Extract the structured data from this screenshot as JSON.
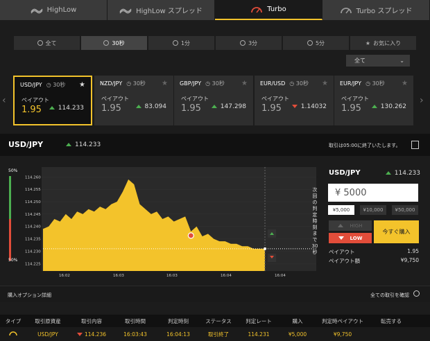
{
  "top_tabs": [
    {
      "label": "HighLow",
      "icon": "highlow-icon",
      "active": false
    },
    {
      "label": "HighLow スプレッド",
      "icon": "highlow-spread-icon",
      "active": false
    },
    {
      "label": "Turbo",
      "icon": "turbo-gauge-icon",
      "active": true
    },
    {
      "label": "Turbo スプレッド",
      "icon": "turbo-spread-gauge-icon",
      "active": false
    }
  ],
  "time_filters": [
    {
      "label": "全て",
      "active": false
    },
    {
      "label": "30秒",
      "active": true
    },
    {
      "label": "1分",
      "active": false
    },
    {
      "label": "3分",
      "active": false
    },
    {
      "label": "5分",
      "active": false
    },
    {
      "label": "お気に入り",
      "active": false
    }
  ],
  "category_select": {
    "value": "全て"
  },
  "asset_cards": [
    {
      "pair": "USD/JPY",
      "duration": "30秒",
      "payout_label": "ペイアウト",
      "payout": "1.95",
      "rate": "114.233",
      "direction": "up",
      "active": true
    },
    {
      "pair": "NZD/JPY",
      "duration": "30秒",
      "payout_label": "ペイアウト",
      "payout": "1.95",
      "rate": "83.094",
      "direction": "up",
      "active": false
    },
    {
      "pair": "GBP/JPY",
      "duration": "30秒",
      "payout_label": "ペイアウト",
      "payout": "1.95",
      "rate": "147.298",
      "direction": "up",
      "active": false
    },
    {
      "pair": "EUR/USD",
      "duration": "30秒",
      "payout_label": "ペイアウト",
      "payout": "1.95",
      "rate": "1.14032",
      "direction": "down",
      "active": false
    },
    {
      "pair": "EUR/JPY",
      "duration": "30秒",
      "payout_label": "ペイアウト",
      "payout": "1.95",
      "rate": "130.262",
      "direction": "up",
      "active": false
    }
  ],
  "asset_header": {
    "pair": "USD/JPY",
    "rate": "114.233",
    "message": "取引は05:00に終了いたします。"
  },
  "chart": {
    "pct_top": "50%",
    "pct_bottom": "50%",
    "y_ticks": [
      "114.260",
      "114.255",
      "114.250",
      "114.245",
      "114.240",
      "114.235",
      "114.230",
      "114.225"
    ],
    "x_ticks": [
      "16:02",
      "16:03",
      "16:03",
      "16:04",
      "16:04"
    ],
    "countdown": "次回の判定時刻まで30秒"
  },
  "chart_data": {
    "type": "area",
    "series": [
      {
        "values": [
          114.239,
          114.24,
          114.243,
          114.242,
          114.245,
          114.243,
          114.246,
          114.245,
          114.247,
          114.246,
          114.248,
          114.247,
          114.249,
          114.25,
          114.254,
          114.259,
          114.257,
          114.249,
          114.247,
          114.245,
          114.246,
          114.243,
          114.244,
          114.242,
          114.243,
          114.244,
          114.238,
          114.24,
          114.236,
          114.237,
          114.235,
          114.234,
          114.234,
          114.233,
          114.233,
          114.232,
          114.232,
          114.231,
          114.231,
          114.231
        ]
      }
    ],
    "ylim": [
      114.222,
      114.264
    ]
  },
  "trade_panel": {
    "pair": "USD/JPY",
    "rate": "114.233",
    "amount": "¥ 5000",
    "presets": [
      "¥5,000",
      "¥10,000",
      "¥50,000"
    ],
    "high_label": "HIGH",
    "low_label": "LOW",
    "buy_label": "今すぐ購入",
    "payout_label": "ペイアウト",
    "payout_value": "1.95",
    "payout_amount_label": "ペイアウト額",
    "payout_amount_value": "¥9,750"
  },
  "details": {
    "title": "購入オプション詳細",
    "link": "全ての取引を確認"
  },
  "table": {
    "headers": [
      "タイプ",
      "取引原資産",
      "取引内容",
      "取引時間",
      "判定時刻",
      "ステータス",
      "判定レート",
      "購入",
      "判定時ペイアウト",
      "転売する"
    ],
    "rows": [
      [
        "",
        "USD/JPY",
        "114.236",
        "16:03:43",
        "16:04:13",
        "取引終了",
        "114.231",
        "¥5,000",
        "¥9,750",
        ""
      ]
    ]
  },
  "colors": {
    "accent": "#f3c32b",
    "up": "#4caf50",
    "down": "#e24d3a"
  }
}
